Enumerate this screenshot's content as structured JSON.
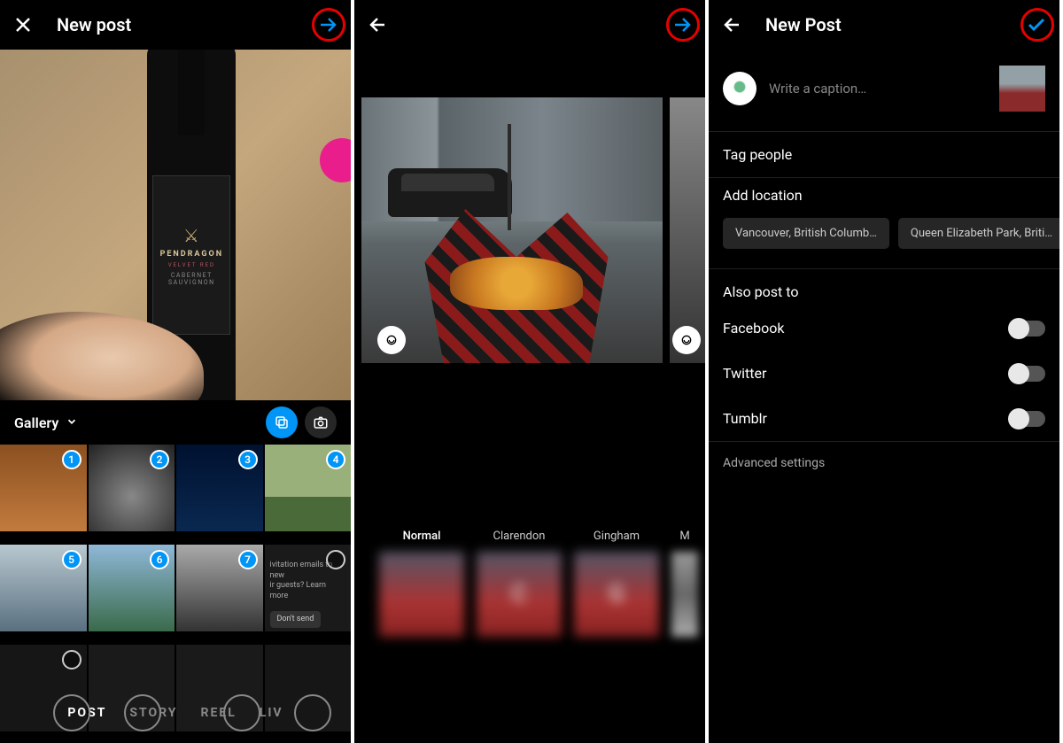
{
  "screen1": {
    "title": "New post",
    "gallery_label": "Gallery",
    "preview": {
      "wine_brand": "PENDRAGON",
      "wine_velvet": "VELVET RED",
      "wine_varietal": "CABERNET SAUVIGNON"
    },
    "thumbs": [
      {
        "badge": "1"
      },
      {
        "badge": "2"
      },
      {
        "badge": "3"
      },
      {
        "badge": "4"
      },
      {
        "badge": "5"
      },
      {
        "badge": "6"
      },
      {
        "badge": "7"
      },
      {
        "text_top": "ivitation emails to new",
        "text_mid": "ir guests? Learn more",
        "btn": "Don't send"
      },
      {},
      {},
      {},
      {}
    ],
    "modes": [
      "POST",
      "STORY",
      "REEL",
      "LIV"
    ]
  },
  "screen2": {
    "filters": [
      {
        "name": "Normal",
        "letter": ""
      },
      {
        "name": "Clarendon",
        "letter": "C"
      },
      {
        "name": "Gingham",
        "letter": "G"
      },
      {
        "name": "M",
        "letter": ""
      }
    ]
  },
  "screen3": {
    "title": "New Post",
    "caption_placeholder": "Write a caption…",
    "tag_people": "Tag people",
    "add_location": "Add location",
    "location_chips": [
      "Vancouver, British Columb…",
      "Queen Elizabeth Park, Briti…"
    ],
    "also_post_to": "Also post to",
    "share_targets": [
      "Facebook",
      "Twitter",
      "Tumblr"
    ],
    "advanced": "Advanced settings"
  }
}
